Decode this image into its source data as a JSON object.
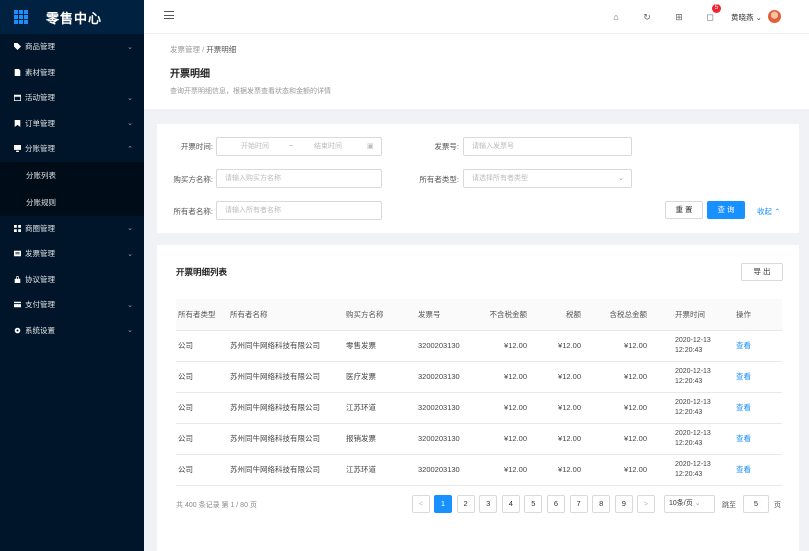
{
  "app": {
    "title": "零售中心"
  },
  "sidebar": {
    "items": [
      {
        "label": "商品管理",
        "icon": "tag-icon",
        "arrow": true
      },
      {
        "label": "素材管理",
        "icon": "file-icon",
        "arrow": false
      },
      {
        "label": "活动管理",
        "icon": "calendar-icon",
        "arrow": true
      },
      {
        "label": "订单管理",
        "icon": "bookmark-icon",
        "arrow": true
      },
      {
        "label": "分账管理",
        "icon": "monitor-icon",
        "arrow": true,
        "expanded": true
      },
      {
        "label": "商圈管理",
        "icon": "grid-icon",
        "arrow": true
      },
      {
        "label": "发票管理",
        "icon": "invoice-icon",
        "arrow": true
      },
      {
        "label": "协议管理",
        "icon": "lock-icon",
        "arrow": false
      },
      {
        "label": "支付管理",
        "icon": "card-icon",
        "arrow": true
      },
      {
        "label": "系统设置",
        "icon": "gear-icon",
        "arrow": true
      }
    ],
    "subitems": [
      {
        "label": "分账列表"
      },
      {
        "label": "分账规则"
      }
    ]
  },
  "header": {
    "username": "黄晓燕",
    "badge": "5"
  },
  "page": {
    "breadcrumb_parent": "发票管理",
    "breadcrumb_sep": "/",
    "breadcrumb_current": "开票明细",
    "title": "开票明细",
    "desc": "查询开票明细信息，根据发票查看状态和金额的详情"
  },
  "search": {
    "time_label": "开票时间:",
    "start_placeholder": "开始时间",
    "range_sep": "~",
    "end_placeholder": "结束时间",
    "invoice_no_label": "发票号:",
    "invoice_no_placeholder": "请输入发票号",
    "buyer_label": "购买方名称:",
    "buyer_placeholder": "请输入购买方名称",
    "owner_type_label": "所有者类型:",
    "owner_type_placeholder": "请选择所有者类型",
    "owner_name_label": "所有者名称:",
    "owner_name_placeholder": "请输入所有者名称",
    "reset_label": "重 置",
    "query_label": "查 询",
    "collapse_label": "收起"
  },
  "table": {
    "title": "开票明细列表",
    "export_label": "导 出",
    "columns": [
      "所有者类型",
      "所有者名称",
      "购买方名称",
      "发票号",
      "不含税金额",
      "税额",
      "含税总金额",
      "开票时间",
      "操作"
    ],
    "rows": [
      {
        "owner_type": "公司",
        "owner_name": "苏州同牛网络科技有限公司",
        "buyer": "零售发票",
        "invoice_no": "3200203130",
        "pre_tax": "¥12.00",
        "tax": "¥12.00",
        "total": "¥12.00",
        "date": "2020-12-13",
        "time": "12:20:43",
        "op": "查看"
      },
      {
        "owner_type": "公司",
        "owner_name": "苏州同牛网络科技有限公司",
        "buyer": "医疗发票",
        "invoice_no": "3200203130",
        "pre_tax": "¥12.00",
        "tax": "¥12.00",
        "total": "¥12.00",
        "date": "2020-12-13",
        "time": "12:20:43",
        "op": "查看"
      },
      {
        "owner_type": "公司",
        "owner_name": "苏州同牛网络科技有限公司",
        "buyer": "江苏环道",
        "invoice_no": "3200203130",
        "pre_tax": "¥12.00",
        "tax": "¥12.00",
        "total": "¥12.00",
        "date": "2020-12-13",
        "time": "12:20:43",
        "op": "查看"
      },
      {
        "owner_type": "公司",
        "owner_name": "苏州同牛网络科技有限公司",
        "buyer": "报销发票",
        "invoice_no": "3200203130",
        "pre_tax": "¥12.00",
        "tax": "¥12.00",
        "total": "¥12.00",
        "date": "2020-12-13",
        "time": "12:20:43",
        "op": "查看"
      },
      {
        "owner_type": "公司",
        "owner_name": "苏州同牛网络科技有限公司",
        "buyer": "江苏环道",
        "invoice_no": "3200203130",
        "pre_tax": "¥12.00",
        "tax": "¥12.00",
        "total": "¥12.00",
        "date": "2020-12-13",
        "time": "12:20:43",
        "op": "查看"
      }
    ]
  },
  "pagination": {
    "total_text": "共 400 条记录 第 1 / 80 页",
    "pages": [
      "1",
      "2",
      "3",
      "4",
      "5",
      "6",
      "7",
      "8",
      "9"
    ],
    "current": "1",
    "prev": "<",
    "next": ">",
    "page_size": "10条/页",
    "jump_label": "跳至",
    "jump_value": "5",
    "jump_suffix": "页"
  },
  "colors": {
    "sidebar_bg": "#001529",
    "accent": "#1890ff",
    "badge": "#f5222d"
  }
}
